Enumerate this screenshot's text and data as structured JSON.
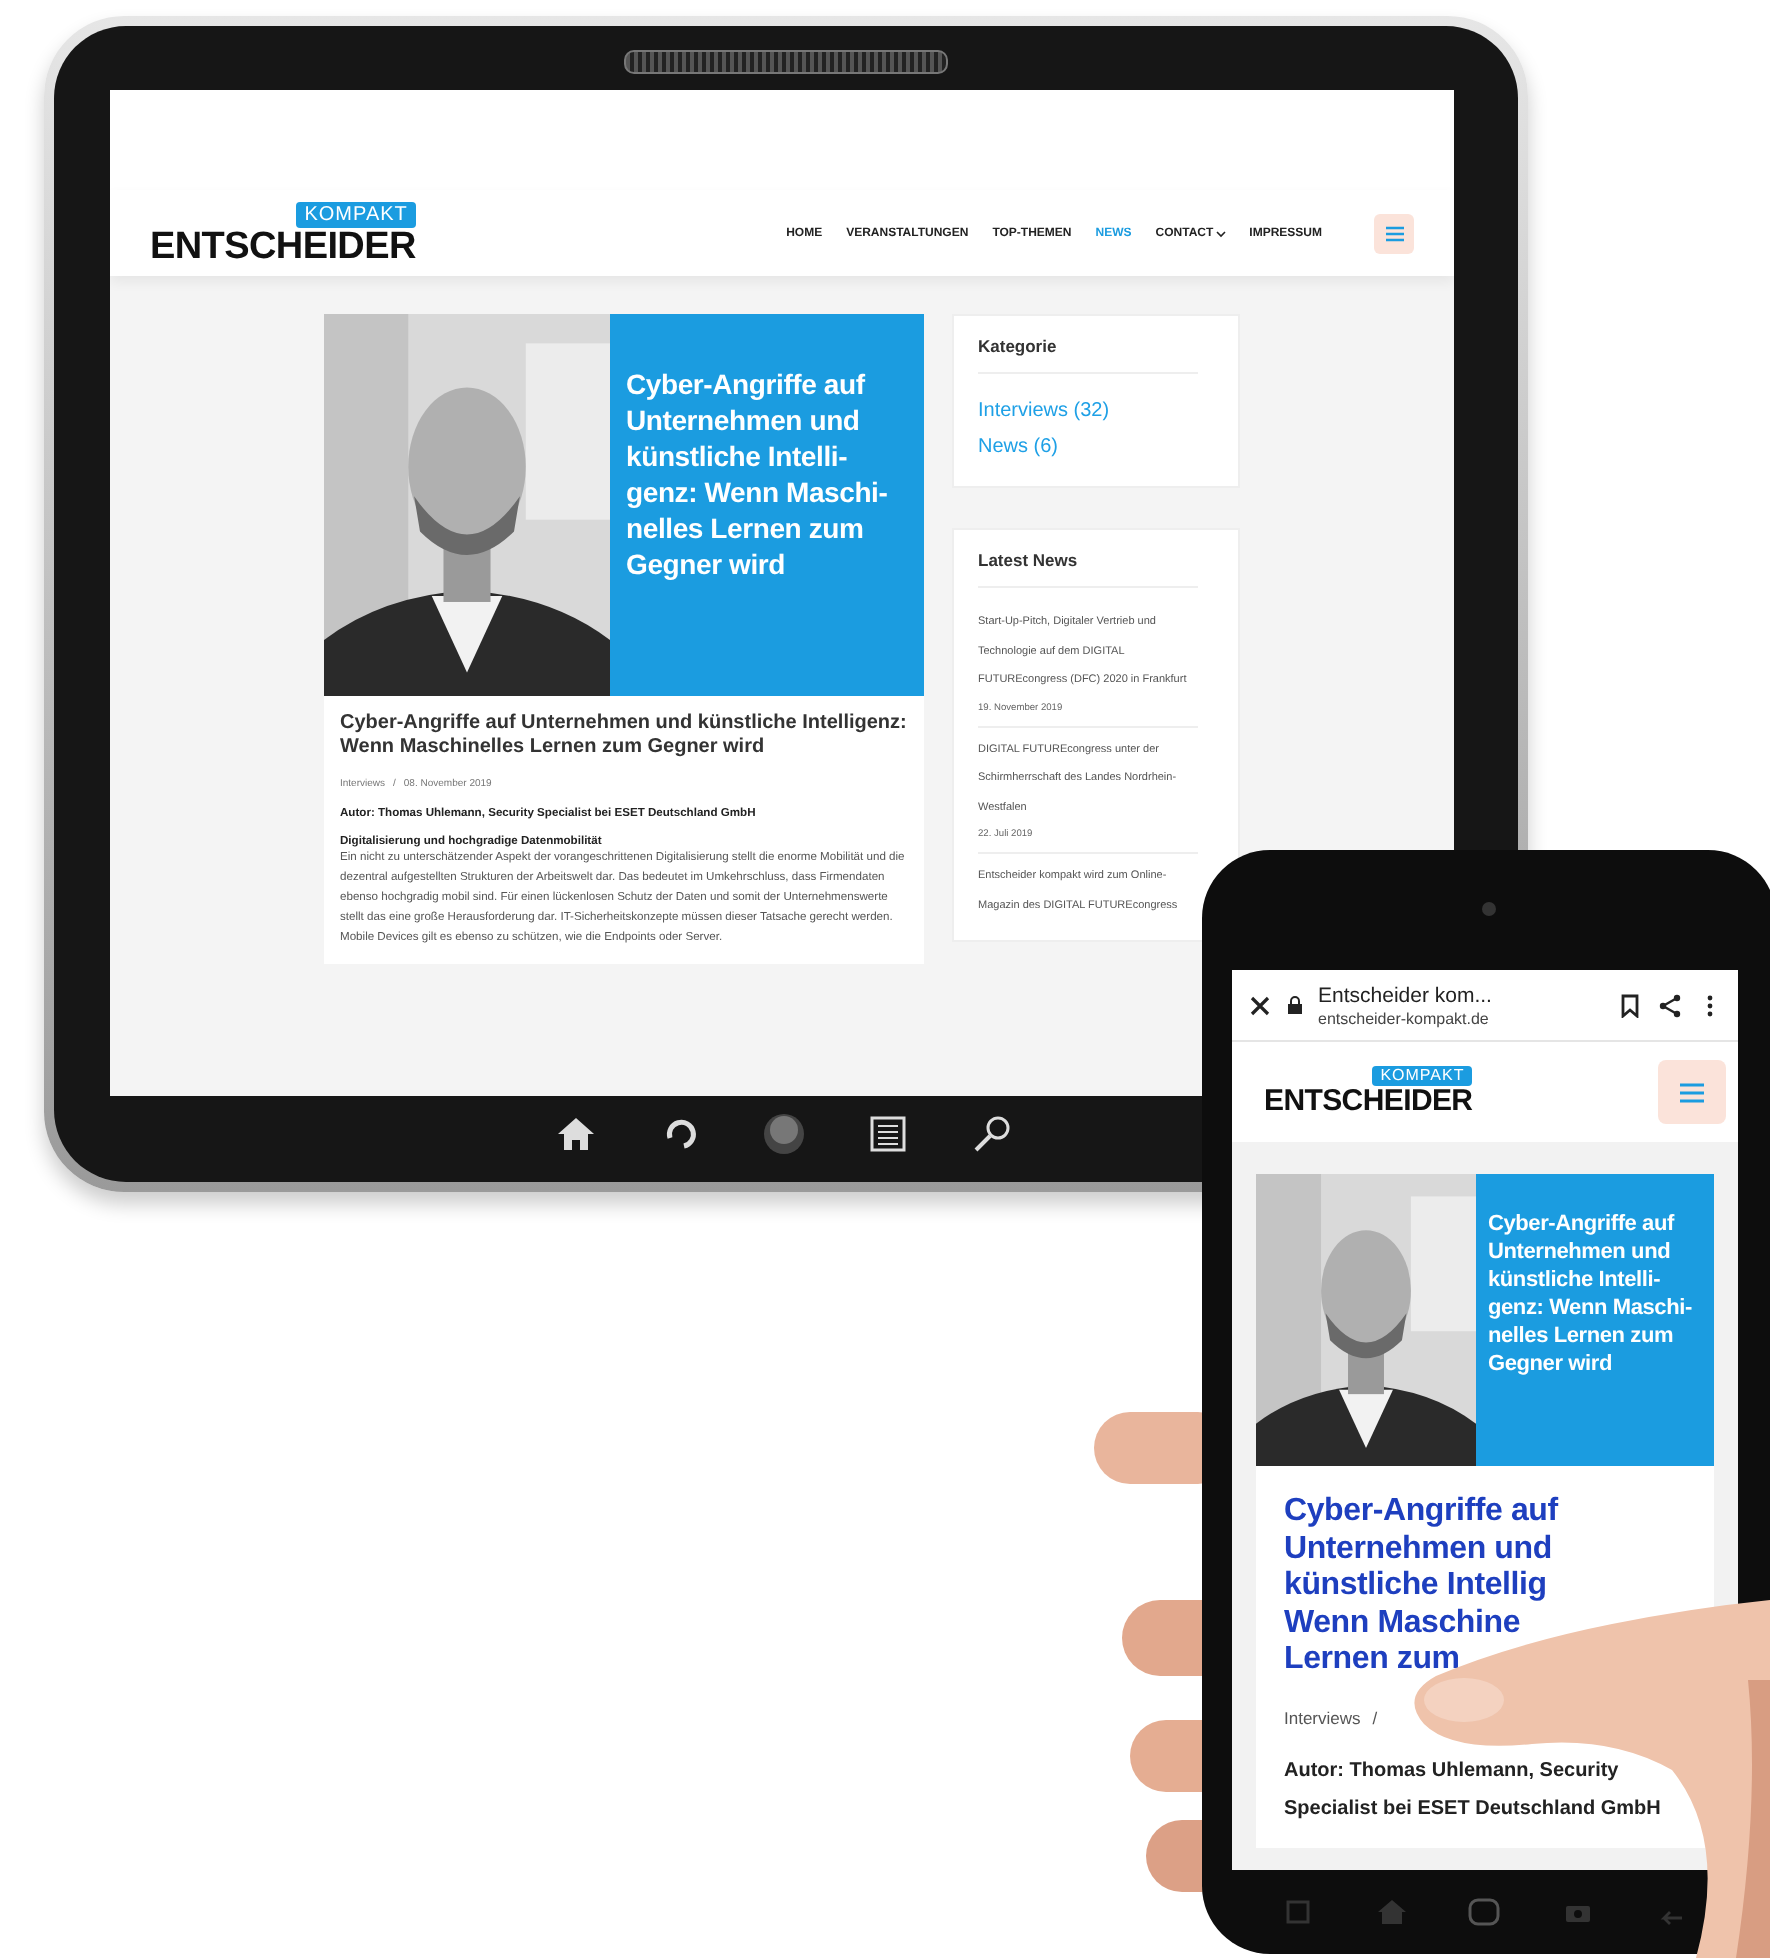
{
  "tablet": {
    "header": {
      "logo_badge": "KOMPAKT",
      "logo": "ENTSCHEIDER",
      "nav": [
        {
          "label": "HOME",
          "selected": false,
          "dropdown": false
        },
        {
          "label": "VERANSTALTUNGEN",
          "selected": false,
          "dropdown": false
        },
        {
          "label": "TOP-THEMEN",
          "selected": false,
          "dropdown": false
        },
        {
          "label": "NEWS",
          "selected": true,
          "dropdown": false
        },
        {
          "label": "CONTACT",
          "selected": false,
          "dropdown": true
        },
        {
          "label": "IMPRESSUM",
          "selected": false,
          "dropdown": false
        }
      ]
    },
    "article": {
      "image_title": [
        "Cyber-Angriffe auf",
        "Unternehmen und",
        "künstliche Intelli-",
        "genz: Wenn Maschi-",
        "nelles Lernen zum",
        "Gegner wird"
      ],
      "title": "Cyber-Angriffe auf Unternehmen und künstliche Intelligenz: Wenn Maschinelles Lernen zum Gegner wird",
      "category": "Interviews",
      "separator": "/",
      "date": "08. November 2019",
      "author": "Autor: Thomas Uhlemann, Security Specialist bei ESET Deutschland GmbH",
      "subheading": "Digitalisierung und hochgradige Datenmobilität",
      "body": "Ein nicht zu unterschätzender Aspekt der vorangeschrittenen Digitalisierung stellt die enorme Mobilität und die dezentral aufgestellten Strukturen der Arbeitswelt dar. Das bedeutet im Umkehrschluss, dass Firmendaten ebenso hochgradig mobil sind. Für einen lückenlosen Schutz der Daten und somit der Unternehmenswerte stellt das eine große Herausforderung dar. IT-Sicherheitskonzepte müssen dieser Tatsache gerecht werden. Mobile Devices gilt es ebenso zu schützen, wie die Endpoints oder Server."
    },
    "sidebar": {
      "categories": {
        "title": "Kategorie",
        "items": [
          "Interviews (32)",
          "News (6)"
        ]
      },
      "latest": {
        "title": "Latest News",
        "items": [
          {
            "title": "Start-Up-Pitch, Digitaler Vertrieb und Technologie auf dem DIGITAL FUTUREcongress (DFC) 2020 in Frankfurt",
            "date": "19. November 2019"
          },
          {
            "title": "DIGITAL FUTUREcongress unter der Schirmherrschaft des Landes Nordrhein-Westfalen",
            "date": "22. Juli 2019"
          },
          {
            "title": "Entscheider kompakt wird zum Online-Magazin des DIGITAL FUTUREcongress"
          }
        ]
      }
    }
  },
  "phone": {
    "browser": {
      "title": "Entscheider kom...",
      "url": "entscheider-kompakt.de"
    },
    "header": {
      "logo_badge": "KOMPAKT",
      "logo": "ENTSCHEIDER"
    },
    "article": {
      "image_title": [
        "Cyber-Angriffe auf",
        "Unternehmen und",
        "künstliche Intelli-",
        "genz: Wenn Maschi-",
        "nelles Lernen zum",
        "Gegner wird"
      ],
      "title_lines": [
        "Cyber-Angriffe auf",
        "Unternehmen und",
        "künstliche Intellig",
        "Wenn Maschine",
        "Lernen zum"
      ],
      "category": "Interviews",
      "separator": "/",
      "author": "Autor: Thomas Uhlemann, Security Specialist bei ESET Deutschland GmbH"
    }
  }
}
